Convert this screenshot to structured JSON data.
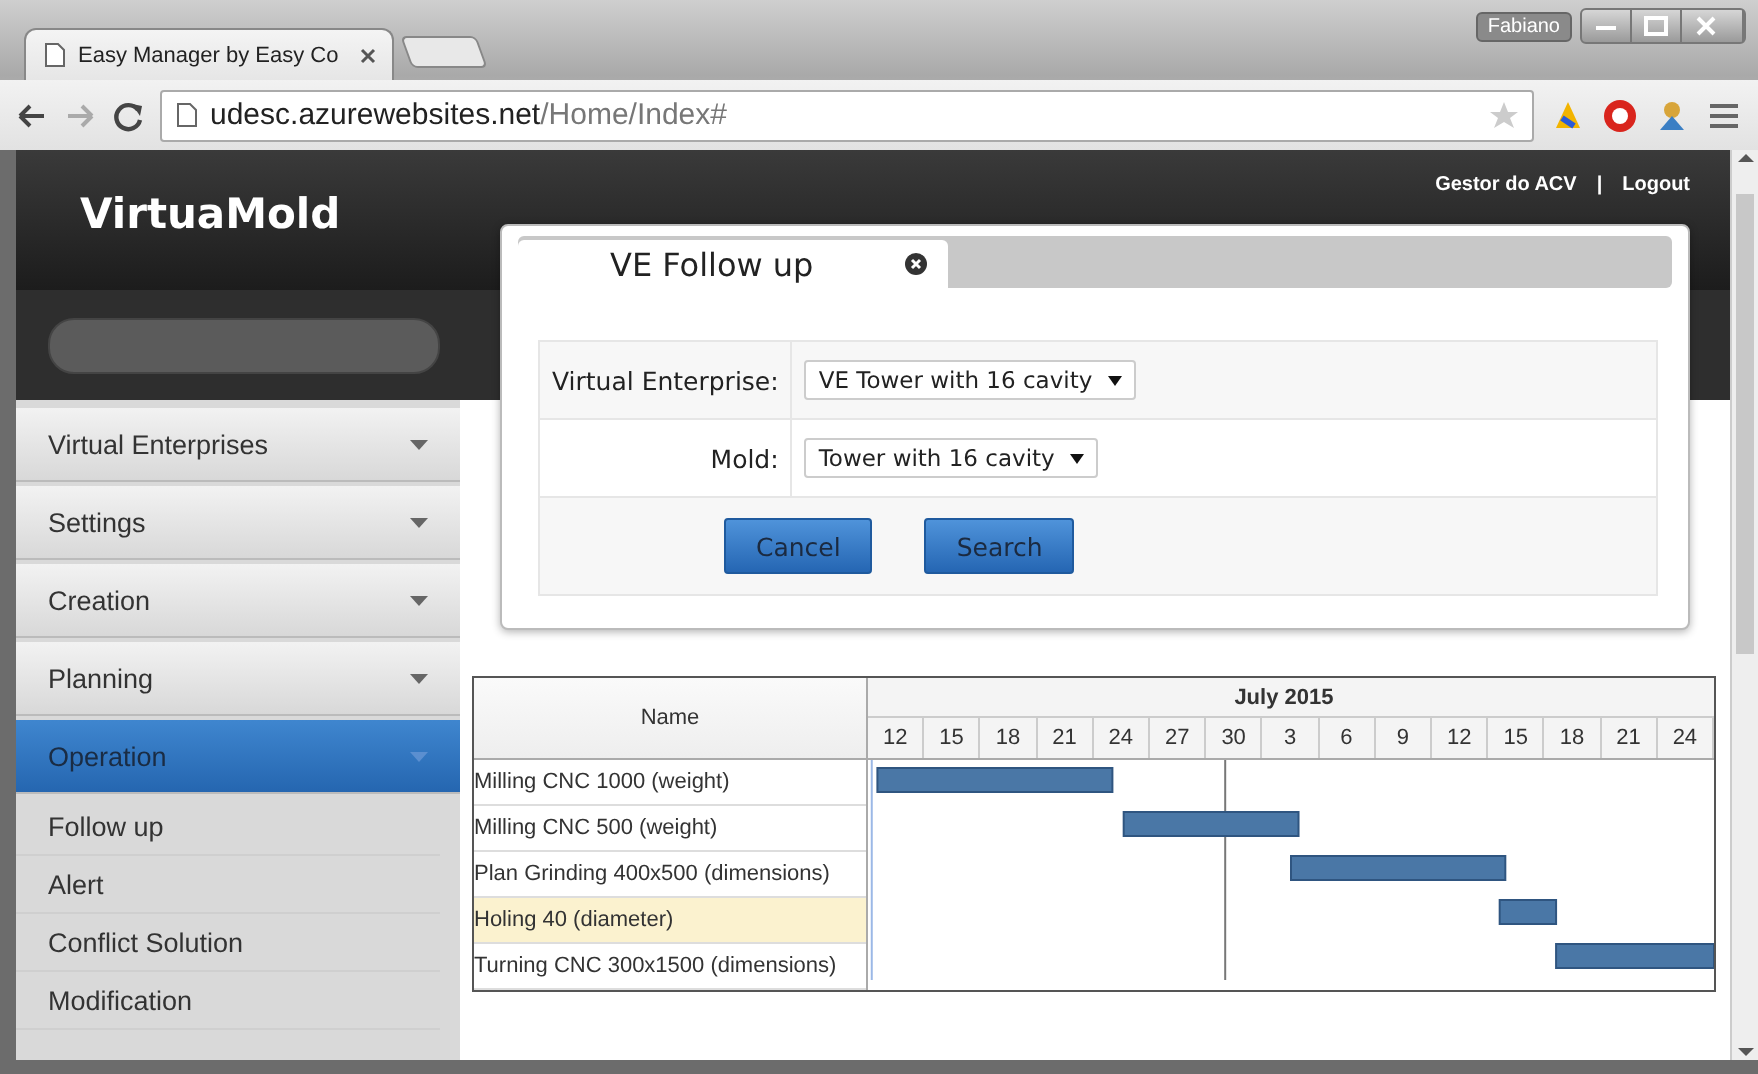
{
  "browser": {
    "tab_title": "Easy Manager by Easy Co",
    "user": "Fabiano",
    "url_host": "udesc.azurewebsites.net",
    "url_path": "/Home/Index#"
  },
  "header": {
    "logo": "VirtuaMold",
    "user": "Gestor do ACV",
    "separator": "|",
    "logout": "Logout"
  },
  "sidebar": {
    "items": [
      {
        "label": "Virtual Enterprises",
        "kind": "menu",
        "selected": false
      },
      {
        "label": "Settings",
        "kind": "menu",
        "selected": false
      },
      {
        "label": "Creation",
        "kind": "menu",
        "selected": false
      },
      {
        "label": "Planning",
        "kind": "menu",
        "selected": false
      },
      {
        "label": "Operation",
        "kind": "menu",
        "selected": true
      },
      {
        "label": "Follow up",
        "kind": "subitem",
        "selected": false
      },
      {
        "label": "Alert",
        "kind": "subitem",
        "selected": false
      },
      {
        "label": "Conflict Solution",
        "kind": "subitem",
        "selected": false
      },
      {
        "label": "Modification",
        "kind": "subitem",
        "selected": false
      }
    ]
  },
  "dialog": {
    "tab": "VE Follow up",
    "fields": [
      {
        "label": "Virtual Enterprise:",
        "value": "VE Tower with 16 cavity"
      },
      {
        "label": "Mold:",
        "value": "Tower with 16 cavity"
      }
    ],
    "buttons": [
      "Cancel",
      "Search"
    ]
  },
  "gantt": {
    "name_header": "Name",
    "month": "July 2015",
    "rows": [
      {
        "name": "Milling CNC 1000 (weight)",
        "selected": false
      },
      {
        "name": "Milling CNC 500 (weight)",
        "selected": false
      },
      {
        "name": "Plan Grinding 400x500 (dimensions)",
        "selected": false
      },
      {
        "name": "Holing 40 (diameter)",
        "selected": true
      },
      {
        "name": "Turning CNC 300x1500 (dimensions)",
        "selected": false
      }
    ],
    "days": [
      "12",
      "15",
      "18",
      "21",
      "24",
      "27",
      "30",
      "3",
      "6",
      "9",
      "12",
      "15",
      "18",
      "21",
      "24"
    ]
  }
}
